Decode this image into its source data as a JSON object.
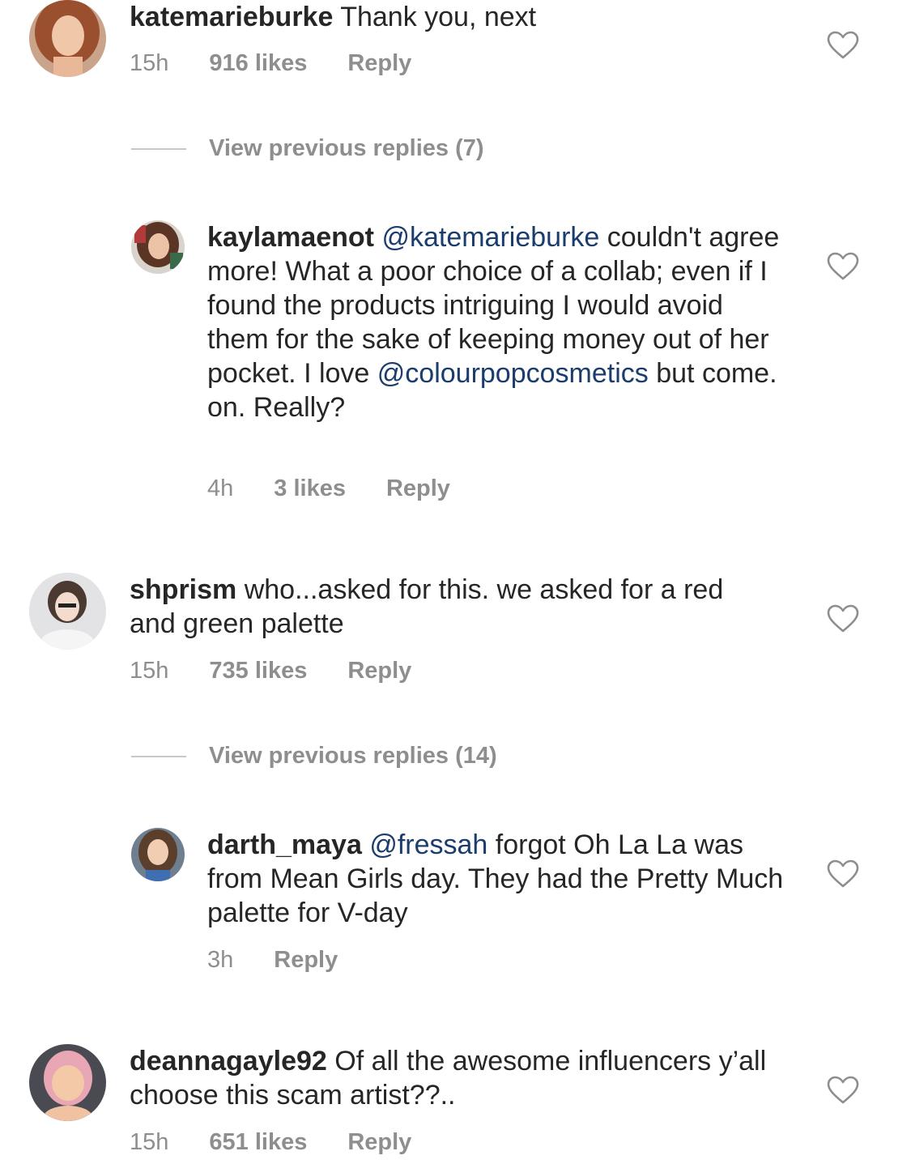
{
  "comments": [
    {
      "username": "katemarieburke",
      "text_parts": [
        " Thank you, next"
      ],
      "time": "15h",
      "likes": "916 likes",
      "reply": "Reply"
    },
    {
      "username": "kaylamaenot",
      "mention1": "@katemarieburke",
      "text1": " couldn't agree more! What a poor choice of a collab; even if I found the products intriguing I would avoid them for the sake of keeping money out of her pocket.  I love ",
      "mention2": "@colourpopcosmetics",
      "text2": " but come. on. Really?",
      "time": "4h",
      "likes": "3 likes",
      "reply": "Reply"
    },
    {
      "username": "shprism",
      "text": " who...asked for this. we asked for a red and green palette",
      "time": "15h",
      "likes": "735 likes",
      "reply": "Reply"
    },
    {
      "username": "darth_maya",
      "mention": "@fressah",
      "text": " forgot Oh La La was from Mean Girls day. They had the Pretty Much palette for V-day",
      "time": "3h",
      "reply": "Reply"
    },
    {
      "username": "deannagayle92",
      "text": " Of all the awesome influencers y’all choose this scam artist??..",
      "time": "15h",
      "likes": "651 likes",
      "reply": "Reply"
    }
  ],
  "view_replies_1": "View previous replies (7)",
  "view_replies_2": "View previous replies (14)",
  "icons": {
    "like": "heart-outline-icon"
  },
  "colors": {
    "text": "#262626",
    "meta": "#8e8e8e",
    "mention": "#1a3d6d"
  }
}
